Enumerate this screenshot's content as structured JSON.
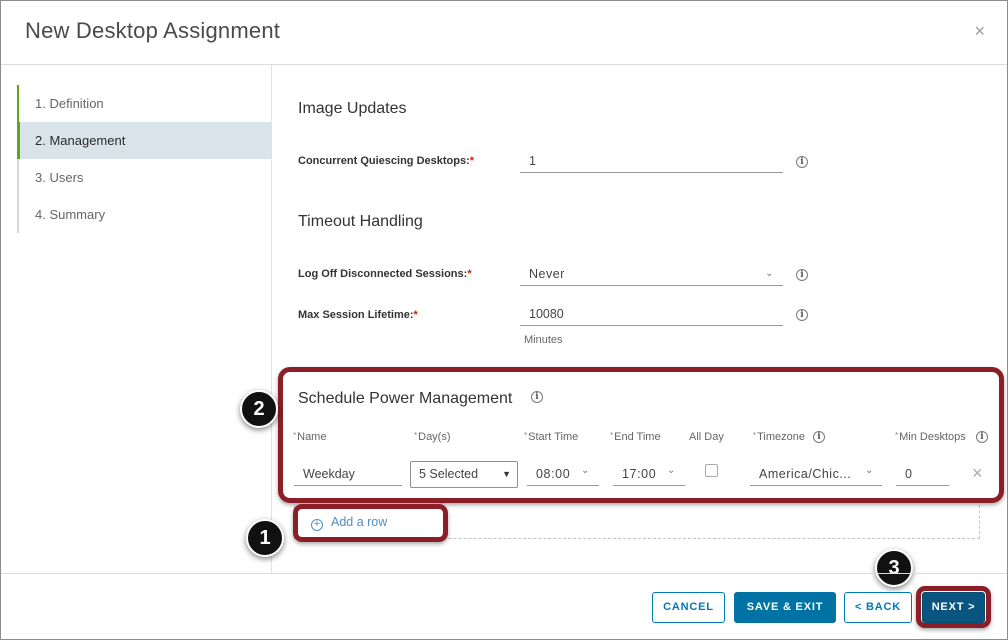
{
  "dialog": {
    "title": "New Desktop Assignment",
    "close_glyph": "×"
  },
  "steps": [
    {
      "label": "1. Definition",
      "state": "done"
    },
    {
      "label": "2. Management",
      "state": "active"
    },
    {
      "label": "3. Users",
      "state": "pending"
    },
    {
      "label": "4. Summary",
      "state": "pending"
    }
  ],
  "image_updates": {
    "heading": "Image Updates",
    "quiescing_label": "Concurrent Quiescing Desktops:",
    "quiescing_value": "1"
  },
  "timeout": {
    "heading": "Timeout Handling",
    "logoff_label": "Log Off Disconnected Sessions:",
    "logoff_value": "Never",
    "max_label": "Max Session Lifetime:",
    "max_value": "10080",
    "max_unit": "Minutes"
  },
  "required_mark": "*",
  "info_glyph": "i",
  "power": {
    "heading": "Schedule Power Management",
    "columns": {
      "name": "Name",
      "days": "Day(s)",
      "start": "Start Time",
      "end": "End Time",
      "allday": "All Day",
      "timezone": "Timezone",
      "min": "Min Desktops"
    },
    "row": {
      "name": "Weekday",
      "days": "5 Selected",
      "start": "08:00",
      "end": "17:00",
      "allday_checked": false,
      "timezone": "America/Chic...",
      "min": "0"
    },
    "add_row": "Add a row",
    "remove_glyph": "×"
  },
  "callouts": {
    "one": "1",
    "two": "2",
    "three": "3",
    "color": "#8b1e26"
  },
  "footer": {
    "cancel": "CANCEL",
    "save_exit": "SAVE & EXIT",
    "back": "< BACK",
    "next": "NEXT >"
  },
  "colors": {
    "accent": "#0072a3",
    "progress": "#62a420",
    "required": "#c92100",
    "link": "#4d8fc5"
  }
}
